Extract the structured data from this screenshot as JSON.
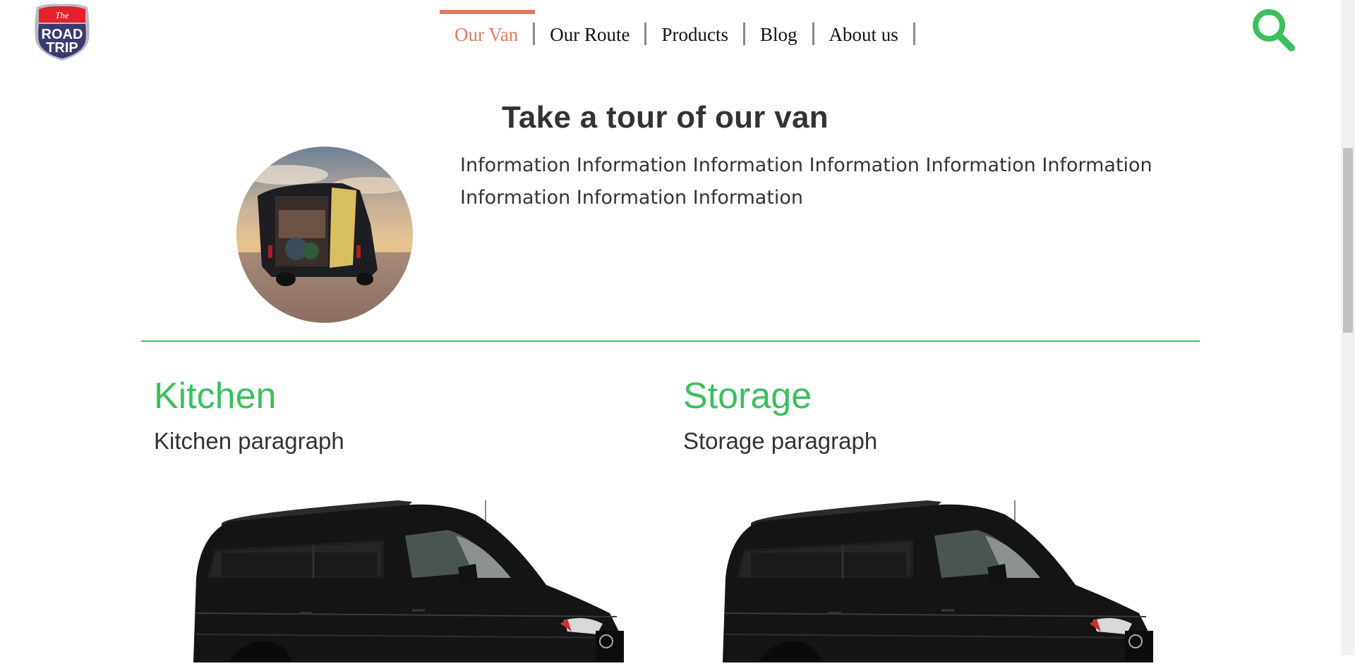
{
  "header": {
    "logo": {
      "line1": "The",
      "line2": "ROAD",
      "line3": "TRIP",
      "icon": "road-trip-shield-logo"
    },
    "nav": [
      {
        "label": "Our Van",
        "active": true
      },
      {
        "label": "Our Route",
        "active": false
      },
      {
        "label": "Products",
        "active": false
      },
      {
        "label": "Blog",
        "active": false
      },
      {
        "label": "About us",
        "active": false
      }
    ],
    "search": {
      "icon": "search-icon"
    }
  },
  "tour": {
    "title": "Take a tour of our van",
    "info": "Information Information Information Information Information Information Information Information Information",
    "photo": {
      "icon": "van-photo"
    }
  },
  "features": [
    {
      "title": "Kitchen",
      "paragraph": "Kitchen paragraph"
    },
    {
      "title": "Storage",
      "paragraph": "Storage paragraph"
    }
  ],
  "colors": {
    "accent_green": "#3cbf5e",
    "active_nav": "#e07a5f",
    "text": "#333333",
    "logo_red": "#e4202a",
    "logo_navy": "#3b3a6e"
  }
}
